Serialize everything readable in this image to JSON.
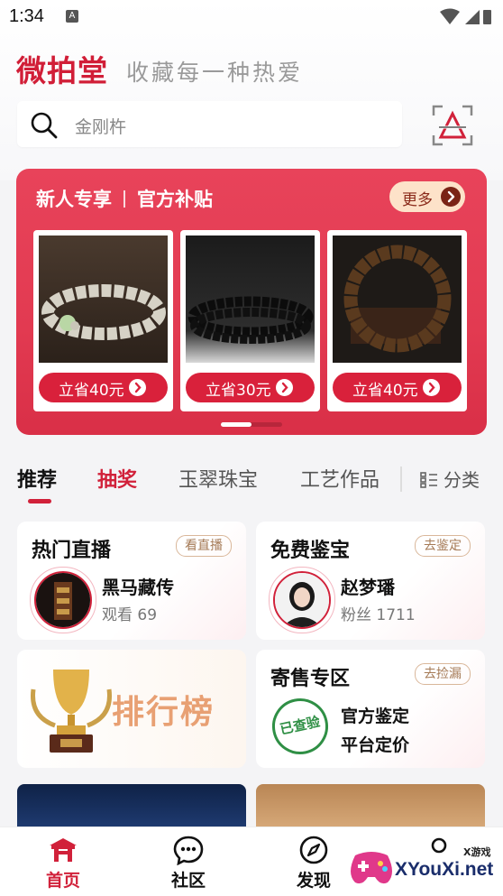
{
  "status_bar": {
    "time": "1:34",
    "notification_icon": "A"
  },
  "header": {
    "logo_text": "微拍堂",
    "slogan": "收藏每一种热爱"
  },
  "search": {
    "placeholder": "金刚杵"
  },
  "promo": {
    "title_left": "新人专享",
    "title_right": "官方补贴",
    "more_label": "更多",
    "items": [
      {
        "label": "立省40元",
        "icon": "bodhi-bracelet"
      },
      {
        "label": "立省30元",
        "icon": "black-bead-bracelet"
      },
      {
        "label": "立省40元",
        "icon": "wood-bead-bracelet"
      }
    ],
    "page": 1,
    "page_count": 2
  },
  "tabs": {
    "items": [
      {
        "label": "推荐",
        "active": true
      },
      {
        "label": "抽奖",
        "highlight": true
      },
      {
        "label": "玉翠珠宝"
      },
      {
        "label": "工艺作品"
      }
    ],
    "category_label": "分类"
  },
  "panels": {
    "live": {
      "title": "热门直播",
      "action": "看直播",
      "name": "黑马藏传",
      "sub": "观看 69"
    },
    "appraisal": {
      "title": "免费鉴宝",
      "action": "去鉴定",
      "name": "赵梦璠",
      "sub": "粉丝 1711"
    },
    "ranking": {
      "label": "排行榜",
      "icon": "trophy-icon"
    },
    "consign": {
      "title": "寄售专区",
      "action": "去捡漏",
      "stamp": "已查验",
      "line1": "官方鉴定",
      "line2": "平台定价"
    }
  },
  "bottom_nav": [
    {
      "label": "首页",
      "icon": "home-pavilion-icon",
      "active": true
    },
    {
      "label": "社区",
      "icon": "chat-bubble-icon"
    },
    {
      "label": "发现",
      "icon": "compass-icon"
    },
    {
      "label": "",
      "icon": "user-icon"
    }
  ],
  "watermark": {
    "brand": "XYouXi.net",
    "tag": "X游戏"
  },
  "colors": {
    "brand_red": "#d1213a",
    "promo_red": "#e23a51",
    "gold": "#fde2c9"
  }
}
